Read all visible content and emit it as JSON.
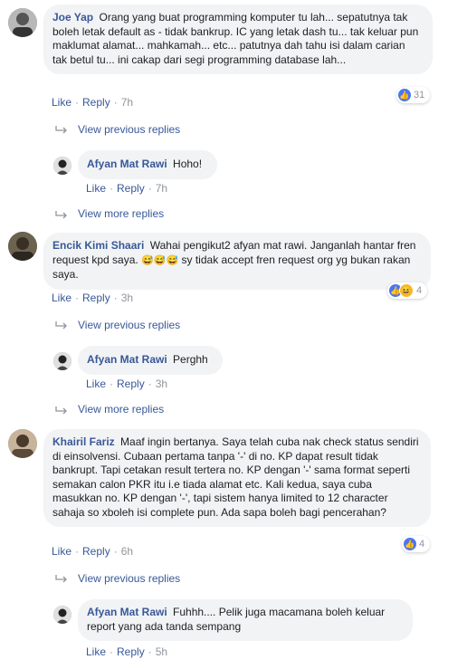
{
  "actions": {
    "like": "Like",
    "reply": "Reply",
    "sep": "·"
  },
  "comments": [
    {
      "name": "Joe Yap",
      "text": "Orang yang buat programming komputer tu lah... sepatutnya tak boleh letak default as - tidak bankrup. IC yang letak dash tu... tak keluar pun maklumat alamat... mahkamah... etc... patutnya dah tahu isi dalam carian tak betul tu... ini cakap dari segi programming database lah...",
      "time": "7h",
      "reactions": "31",
      "view_replies": "View previous replies",
      "reply": {
        "name": "Afyan Mat Rawi",
        "text": "Hoho!",
        "time": "7h"
      },
      "view_more": "View more replies"
    },
    {
      "name": "Encik Kimi Shaari",
      "text_before": "Wahai pengikut2 afyan mat rawi. Janganlah hantar fren request kpd saya.",
      "emojis": "😅😅😅",
      "text_after": "sy tidak accept fren request org yg bukan rakan saya.",
      "time": "3h",
      "reactions": "4",
      "view_replies": "View previous replies",
      "reply": {
        "name": "Afyan Mat Rawi",
        "text": "Perghh",
        "time": "3h"
      },
      "view_more": "View more replies"
    },
    {
      "name": "Khairil Fariz",
      "text": "Maaf ingin bertanya. Saya telah cuba nak check status sendiri di einsolvensi. Cubaan pertama tanpa '-' di no. KP dapat result tidak bankrupt. Tapi cetakan result tertera no. KP dengan '-' sama format seperti semakan calon PKR itu i.e tiada alamat etc. Kali kedua, saya cuba masukkan no. KP dengan '-', tapi sistem hanya limited to 12 character sahaja so xboleh isi complete pun. Ada sapa boleh bagi pencerahan?",
      "time": "6h",
      "reactions": "4",
      "view_replies": "View previous replies",
      "reply": {
        "name": "Afyan Mat Rawi",
        "text": "Fuhhh.... Pelik juga macamana boleh keluar report yang ada tanda sempang",
        "time": "5h"
      }
    }
  ],
  "icons": {
    "like": "thumbs-up-icon",
    "haha": "laughing-face-icon",
    "reply": "reply-arrow-icon"
  },
  "colors": {
    "link": "#385898",
    "bubble": "#f2f3f5",
    "like": "#4a76f3",
    "muted": "#90949c"
  }
}
